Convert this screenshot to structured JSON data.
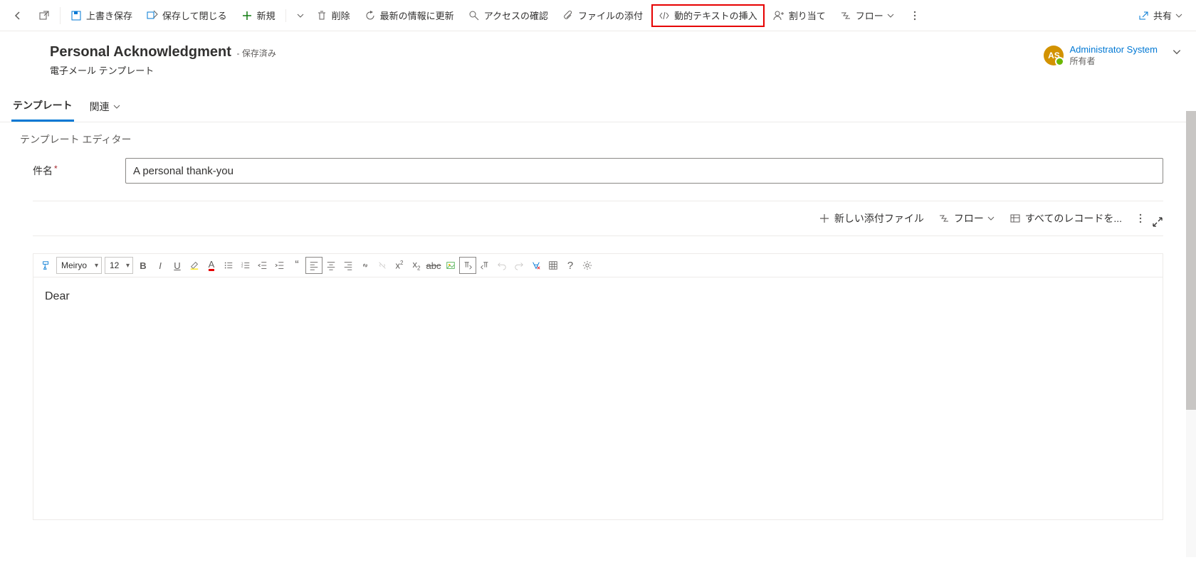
{
  "toolbar": {
    "save": "上書き保存",
    "save_close": "保存して閉じる",
    "new": "新規",
    "delete": "削除",
    "refresh": "最新の情報に更新",
    "access": "アクセスの確認",
    "attach": "ファイルの添付",
    "dynamic_text": "動的テキストの挿入",
    "assign": "割り当て",
    "flow": "フロー",
    "share": "共有"
  },
  "header": {
    "title": "Personal Acknowledgment",
    "saved_suffix": "- 保存済み",
    "subtitle": "電子メール テンプレート",
    "owner_name": "Administrator System",
    "owner_role": "所有者",
    "avatar_initials": "AS"
  },
  "tabs": {
    "tab1": "テンプレート",
    "tab2": "関連"
  },
  "editor": {
    "section_title": "テンプレート エディター",
    "subject_label": "件名",
    "subject_value": "A personal thank-you",
    "body": "Dear"
  },
  "subbar": {
    "new_attachment": "新しい添付ファイル",
    "flow": "フロー",
    "all_records": "すべてのレコードを..."
  },
  "rte": {
    "font": "Meiryo",
    "size": "12"
  }
}
